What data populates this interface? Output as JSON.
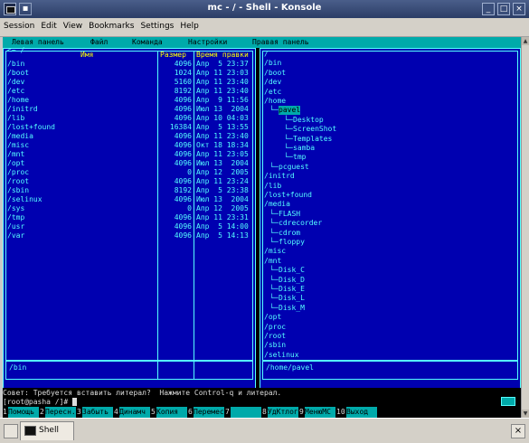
{
  "window": {
    "title": "mc - / - Shell - Konsole",
    "buttons": {
      "minimize": "_",
      "maximize": "□",
      "close": "×",
      "pin": "▪"
    }
  },
  "menubar": [
    "Session",
    "Edit",
    "View",
    "Bookmarks",
    "Settings",
    "Help"
  ],
  "mc_menu": {
    "left": "Левая панель",
    "file": "Файл",
    "command": "Команда",
    "settings": "Настройки",
    "right": "Правая панель"
  },
  "left_panel": {
    "path_top": "<~ /",
    "header_name": "Имя",
    "header_size": "Размер",
    "header_time": "Время правки",
    "rows": [
      {
        "name": "/bin",
        "size": "4096",
        "time": "Апр  5 23:37"
      },
      {
        "name": "/boot",
        "size": "1024",
        "time": "Апр 11 23:03"
      },
      {
        "name": "/dev",
        "size": "5160",
        "time": "Апр 11 23:40"
      },
      {
        "name": "/etc",
        "size": "8192",
        "time": "Апр 11 23:40"
      },
      {
        "name": "/home",
        "size": "4096",
        "time": "Апр  9 11:56"
      },
      {
        "name": "/initrd",
        "size": "4096",
        "time": "Июл 13  2004"
      },
      {
        "name": "/lib",
        "size": "4096",
        "time": "Апр 10 04:03"
      },
      {
        "name": "/lost+found",
        "size": "16384",
        "time": "Апр  5 13:55"
      },
      {
        "name": "/media",
        "size": "4096",
        "time": "Апр 11 23:40"
      },
      {
        "name": "/misc",
        "size": "4096",
        "time": "Окт 18 18:34"
      },
      {
        "name": "/mnt",
        "size": "4096",
        "time": "Апр 11 23:05"
      },
      {
        "name": "/opt",
        "size": "4096",
        "time": "Июл 13  2004"
      },
      {
        "name": "/proc",
        "size": "0",
        "time": "Апр 12  2005"
      },
      {
        "name": "/root",
        "size": "4096",
        "time": "Апр 11 23:24"
      },
      {
        "name": "/sbin",
        "size": "8192",
        "time": "Апр  5 23:38"
      },
      {
        "name": "/selinux",
        "size": "4096",
        "time": "Июл 13  2004"
      },
      {
        "name": "/sys",
        "size": "0",
        "time": "Апр 12  2005"
      },
      {
        "name": "/tmp",
        "size": "4096",
        "time": "Апр 11 23:31"
      },
      {
        "name": "/usr",
        "size": "4096",
        "time": "Апр  5 14:00"
      },
      {
        "name": "/var",
        "size": "4096",
        "time": "Апр  5 14:13"
      }
    ],
    "mini_status": "/bin"
  },
  "right_panel": {
    "tree": [
      {
        "text": "/",
        "indent": 0
      },
      {
        "text": "/bin",
        "indent": 0
      },
      {
        "text": "/boot",
        "indent": 0
      },
      {
        "text": "/dev",
        "indent": 0
      },
      {
        "text": "/etc",
        "indent": 0
      },
      {
        "text": "/home",
        "indent": 0
      },
      {
        "text": "pavel",
        "indent": 1,
        "selected": true
      },
      {
        "text": "Desktop",
        "indent": 2
      },
      {
        "text": "ScreenShot",
        "indent": 2
      },
      {
        "text": "Templates",
        "indent": 2
      },
      {
        "text": "samba",
        "indent": 2
      },
      {
        "text": "tmp",
        "indent": 2
      },
      {
        "text": "pcguest",
        "indent": 1
      },
      {
        "text": "/initrd",
        "indent": 0
      },
      {
        "text": "/lib",
        "indent": 0
      },
      {
        "text": "/lost+found",
        "indent": 0
      },
      {
        "text": "/media",
        "indent": 0
      },
      {
        "text": "FLASH",
        "indent": 1
      },
      {
        "text": "cdrecorder",
        "indent": 1
      },
      {
        "text": "cdrom",
        "indent": 1
      },
      {
        "text": "floppy",
        "indent": 1
      },
      {
        "text": "/misc",
        "indent": 0
      },
      {
        "text": "/mnt",
        "indent": 0
      },
      {
        "text": "Disk_C",
        "indent": 1
      },
      {
        "text": "Disk_D",
        "indent": 1
      },
      {
        "text": "Disk_E",
        "indent": 1
      },
      {
        "text": "Disk_L",
        "indent": 1
      },
      {
        "text": "Disk_M",
        "indent": 1
      },
      {
        "text": "/opt",
        "indent": 0
      },
      {
        "text": "/proc",
        "indent": 0
      },
      {
        "text": "/root",
        "indent": 0
      },
      {
        "text": "/sbin",
        "indent": 0
      },
      {
        "text": "/selinux",
        "indent": 0
      }
    ],
    "mini_status": "/home/pavel"
  },
  "hint": "Совет: Требуется вставить литерал?  Нажмите Control-q и литерал.",
  "prompt": "[root@pasha /]# ",
  "fkeys": [
    {
      "num": "1",
      "label": "Помощь"
    },
    {
      "num": "2",
      "label": "Пересн."
    },
    {
      "num": "3",
      "label": "Забыть"
    },
    {
      "num": "4",
      "label": "Динамч"
    },
    {
      "num": "5",
      "label": "Копия"
    },
    {
      "num": "6",
      "label": "Перемес"
    },
    {
      "num": "7",
      "label": ""
    },
    {
      "num": "8",
      "label": "УдКтлог"
    },
    {
      "num": "9",
      "label": "МенюМС"
    },
    {
      "num": "10",
      "label": "Выход"
    }
  ],
  "tabs": [
    {
      "label": "Shell",
      "icon": "terminal-icon"
    }
  ],
  "colors": {
    "panel_bg": "#0000b0",
    "panel_fg": "#55ffff",
    "bar_bg": "#00aaaa",
    "header_fg": "#ffff00"
  }
}
